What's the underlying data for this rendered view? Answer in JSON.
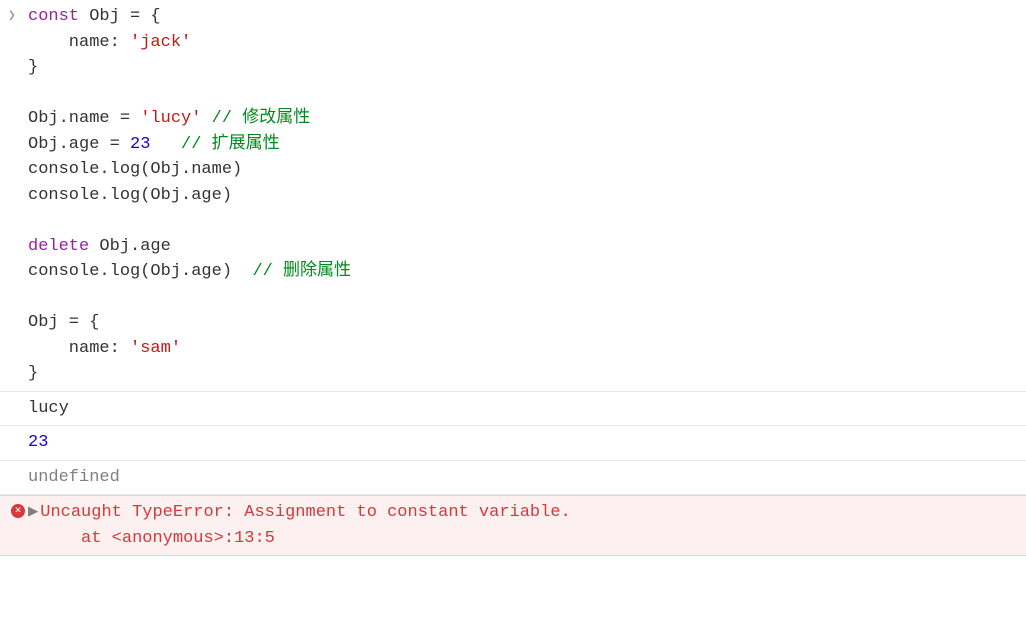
{
  "input": {
    "prompt_glyph": "❯",
    "lines": [
      {
        "tokens": [
          {
            "t": "const ",
            "c": "kw-const"
          },
          {
            "t": "Obj = {",
            "c": "kw-plain"
          }
        ]
      },
      {
        "tokens": [
          {
            "t": "    name: ",
            "c": "kw-plain"
          },
          {
            "t": "'jack'",
            "c": "kw-string"
          }
        ]
      },
      {
        "tokens": [
          {
            "t": "}",
            "c": "kw-plain"
          }
        ]
      },
      {
        "tokens": [
          {
            "t": "",
            "c": "kw-plain"
          }
        ]
      },
      {
        "tokens": [
          {
            "t": "Obj.name = ",
            "c": "kw-plain"
          },
          {
            "t": "'lucy'",
            "c": "kw-string"
          },
          {
            "t": " // 修改属性",
            "c": "kw-comment"
          }
        ]
      },
      {
        "tokens": [
          {
            "t": "Obj.age = ",
            "c": "kw-plain"
          },
          {
            "t": "23",
            "c": "kw-num"
          },
          {
            "t": "   // 扩展属性",
            "c": "kw-comment"
          }
        ]
      },
      {
        "tokens": [
          {
            "t": "console.log(Obj.name)",
            "c": "kw-plain"
          }
        ]
      },
      {
        "tokens": [
          {
            "t": "console.log(Obj.age)",
            "c": "kw-plain"
          }
        ]
      },
      {
        "tokens": [
          {
            "t": "",
            "c": "kw-plain"
          }
        ]
      },
      {
        "tokens": [
          {
            "t": "delete ",
            "c": "kw-delete"
          },
          {
            "t": "Obj.age",
            "c": "kw-plain"
          }
        ]
      },
      {
        "tokens": [
          {
            "t": "console.log(Obj.age)  ",
            "c": "kw-plain"
          },
          {
            "t": "// 删除属性",
            "c": "kw-comment"
          }
        ]
      },
      {
        "tokens": [
          {
            "t": "",
            "c": "kw-plain"
          }
        ]
      },
      {
        "tokens": [
          {
            "t": "Obj = {",
            "c": "kw-plain"
          }
        ]
      },
      {
        "tokens": [
          {
            "t": "    name: ",
            "c": "kw-plain"
          },
          {
            "t": "'sam'",
            "c": "kw-string"
          }
        ]
      },
      {
        "tokens": [
          {
            "t": "}",
            "c": "kw-plain"
          }
        ]
      }
    ]
  },
  "outputs": [
    {
      "text": "lucy",
      "cls": "output-text"
    },
    {
      "text": "23",
      "cls": "kw-num"
    },
    {
      "text": "undefined",
      "cls": "kw-undef"
    }
  ],
  "error": {
    "icon_glyph": "✕",
    "arrow_glyph": "▶",
    "line1": "Uncaught TypeError: Assignment to constant variable.",
    "line2": "    at <anonymous>:13:5"
  }
}
